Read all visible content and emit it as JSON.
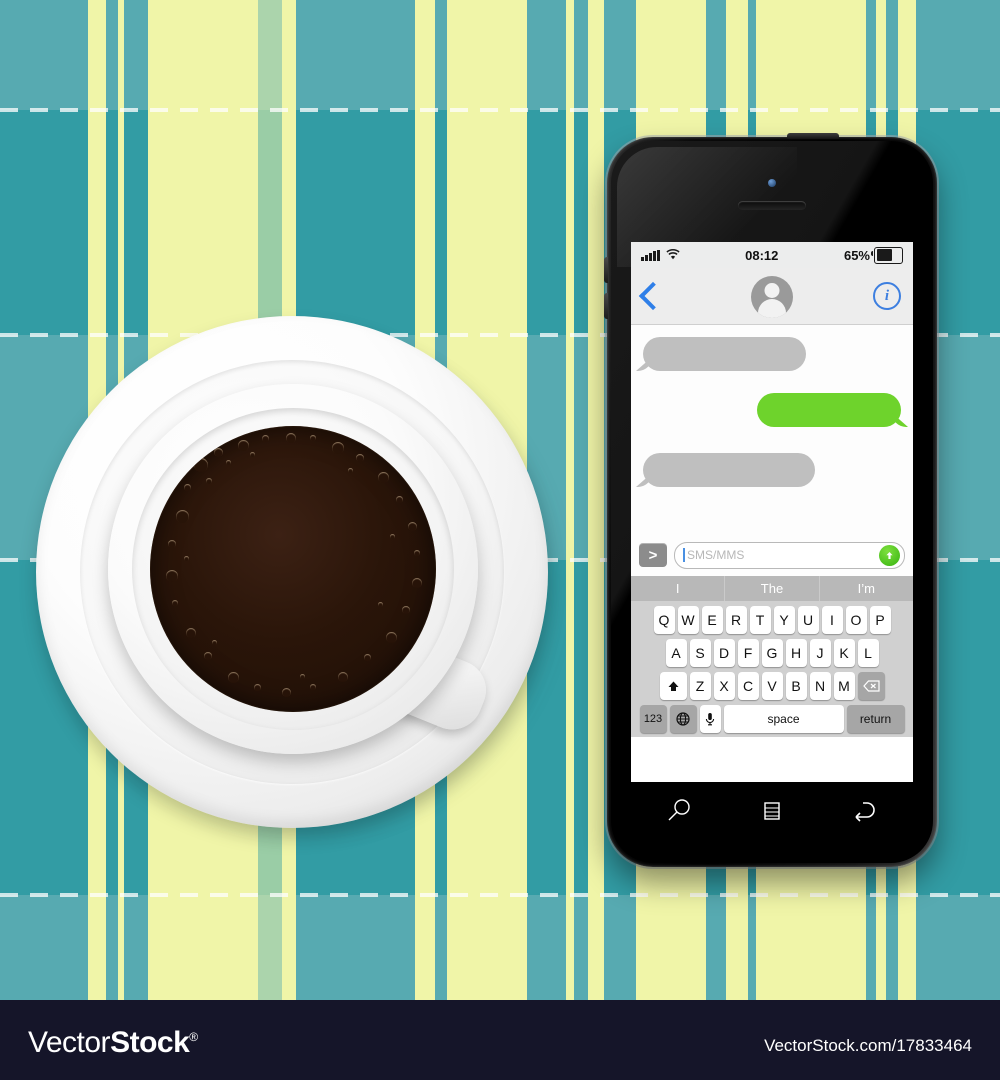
{
  "scene": {
    "description": "Coffee cup and smartphone with SMS chat on plaid tablecloth",
    "background_colors": {
      "teal_light": "#57aab1",
      "teal_dark": "#2b9aa2",
      "yellow": "#f0f5a8",
      "dash_line": "#ffffff"
    }
  },
  "phone": {
    "status_bar": {
      "signal_label": "signal-bars",
      "wifi_label": "wifi",
      "time": "08:12",
      "battery_percent": "65%",
      "battery_level": 65
    },
    "nav_bar": {
      "back_label": "back-chevron",
      "avatar_label": "contact-avatar",
      "info_label": "i"
    },
    "conversation": {
      "messages": [
        {
          "side": "incoming",
          "text": ""
        },
        {
          "side": "outgoing",
          "text": ""
        },
        {
          "side": "incoming",
          "text": ""
        }
      ],
      "bubble_colors": {
        "incoming": "#bfbfbf",
        "outgoing": "#6ed32c"
      }
    },
    "input_bar": {
      "attach_label": ">",
      "placeholder": "SMS/MMS",
      "value": "",
      "send_label": "send-arrow"
    },
    "keyboard": {
      "predictions": [
        "I",
        "The",
        "I’m"
      ],
      "row1": [
        "Q",
        "W",
        "E",
        "R",
        "T",
        "Y",
        "U",
        "I",
        "O",
        "P"
      ],
      "row2": [
        "A",
        "S",
        "D",
        "F",
        "G",
        "H",
        "J",
        "K",
        "L"
      ],
      "row3": [
        "Z",
        "X",
        "C",
        "V",
        "B",
        "N",
        "M"
      ],
      "shift_label": "shift",
      "backspace_label": "backspace",
      "numeric_label": "123",
      "globe_label": "globe",
      "mic_label": "microphone",
      "space_label": "space",
      "return_label": "return"
    },
    "hardware_nav": {
      "search_label": "search",
      "menu_label": "menu",
      "back_label": "back"
    }
  },
  "coffee": {
    "cup_color": "#ffffff",
    "coffee_color": "#2a1509",
    "crema_color": "#c4945 6"
  },
  "footer": {
    "brand_prefix": "Vector",
    "brand_suffix": "Stock",
    "brand_mark": "®",
    "url": "VectorStock.com/17833464"
  }
}
